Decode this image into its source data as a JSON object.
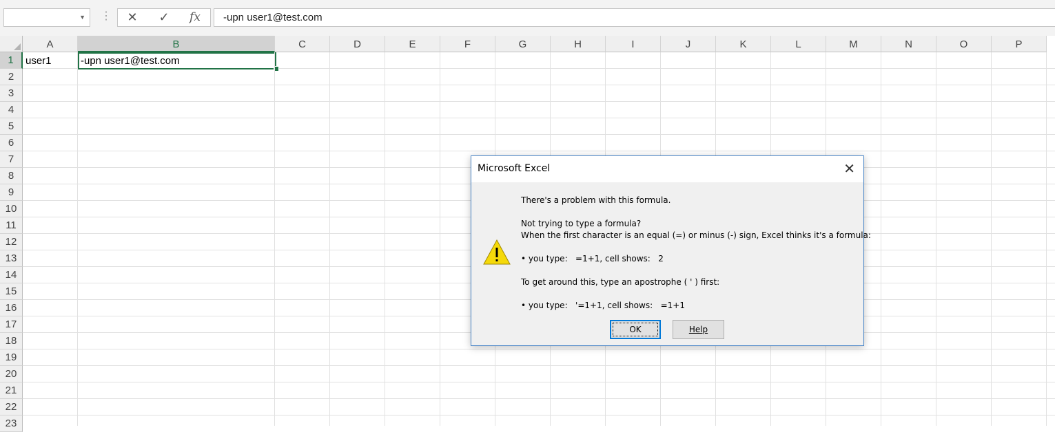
{
  "formula_bar": {
    "name_box": "",
    "cancel_glyph": "✕",
    "enter_glyph": "✓",
    "fx_label": "fx",
    "formula": "-upn user1@test.com"
  },
  "columns": [
    "A",
    "B",
    "C",
    "D",
    "E",
    "F",
    "G",
    "H",
    "I",
    "J",
    "K",
    "L",
    "M",
    "N",
    "O",
    "P"
  ],
  "rows": [
    "1",
    "2",
    "3",
    "4",
    "5",
    "6",
    "7",
    "8",
    "9",
    "10",
    "11",
    "12",
    "13",
    "14",
    "15",
    "16",
    "17",
    "18",
    "19",
    "20",
    "21",
    "22",
    "23"
  ],
  "cells": {
    "A1": "user1",
    "B1": "-upn user1@test.com"
  },
  "selected_cell": "B1",
  "dialog": {
    "title": "Microsoft Excel",
    "icon": "warning-icon",
    "line1": "There's a problem with this formula.",
    "line2": "Not trying to type a formula?",
    "line3": "When the first character is an equal (=) or minus (-) sign, Excel thinks it's a formula:",
    "line4": "• you type:   =1+1, cell shows:   2",
    "line5": "To get around this, type an apostrophe ( ' ) first:",
    "line6": "• you type:   '=1+1, cell shows:   =1+1",
    "ok_label": "OK",
    "help_label": "Help"
  },
  "colors": {
    "accent": "#217346",
    "dialog_border": "#4a86c8",
    "warning": "#f5d90a"
  }
}
